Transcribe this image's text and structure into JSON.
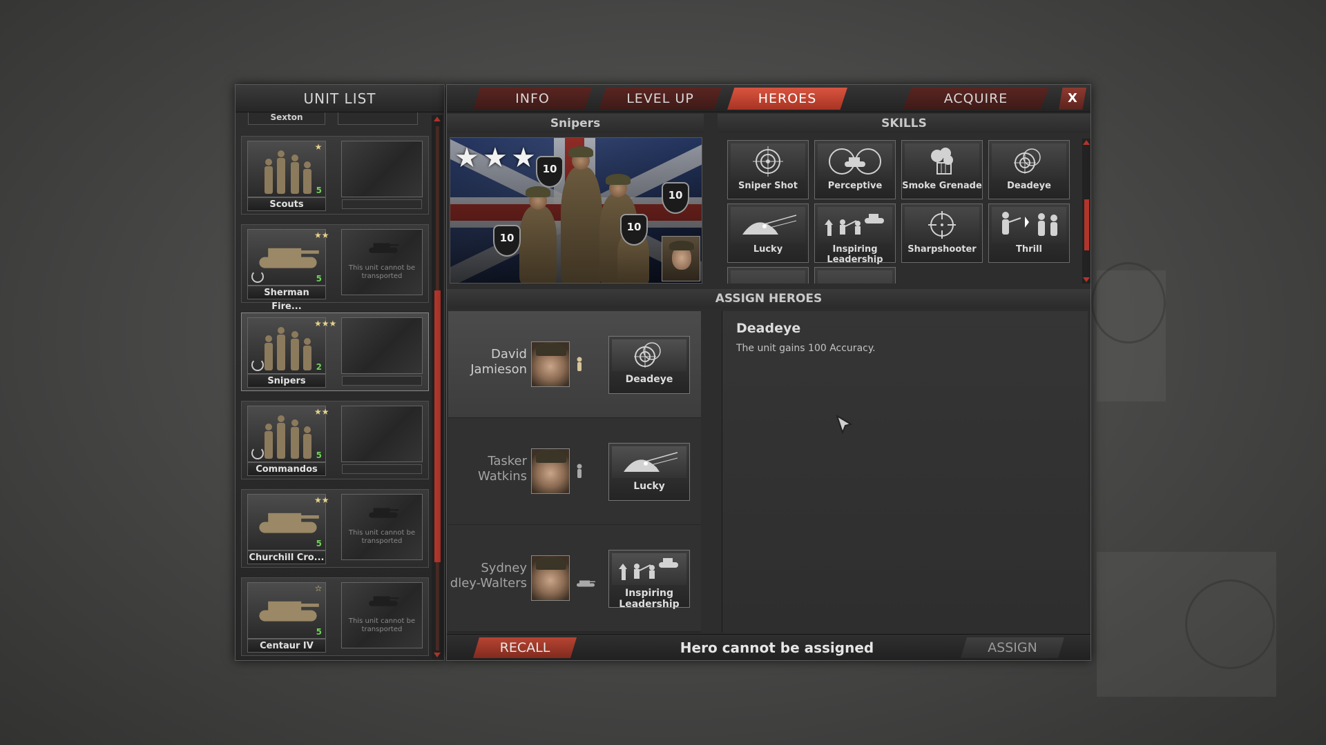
{
  "unit_list": {
    "title": "UNIT LIST",
    "partial_top_unit": "Sexton",
    "units": [
      {
        "name": "Scouts",
        "stars": "★",
        "count": "5",
        "veteran": false,
        "kind": "infantry",
        "transport": "empty"
      },
      {
        "name": "Sherman Fire...",
        "stars": "★★",
        "count": "5",
        "veteran": true,
        "kind": "tank",
        "transport": "none"
      },
      {
        "name": "Snipers",
        "stars": "★★★",
        "count": "2",
        "veteran": true,
        "kind": "infantry",
        "transport": "empty",
        "selected": true
      },
      {
        "name": "Commandos",
        "stars": "★★",
        "count": "5",
        "veteran": true,
        "kind": "infantry",
        "transport": "empty"
      },
      {
        "name": "Churchill Cro...",
        "stars": "★★",
        "count": "5",
        "veteran": false,
        "kind": "tank",
        "transport": "none"
      },
      {
        "name": "Centaur IV",
        "stars": "☆",
        "count": "5",
        "veteran": false,
        "kind": "tank",
        "transport": "none"
      }
    ],
    "no_transport_text": "This unit cannot be transported"
  },
  "tabs": {
    "info": "INFO",
    "level_up": "LEVEL UP",
    "heroes": "HEROES",
    "acquire": "ACQUIRE",
    "close": "X"
  },
  "unit_panel": {
    "title": "Snipers",
    "stars": "★★★",
    "ranks": [
      "10",
      "10",
      "10",
      "10"
    ]
  },
  "skills": {
    "title": "SKILLS",
    "items": [
      {
        "label": "Sniper Shot",
        "icon": "crosshair-icon"
      },
      {
        "label": "Perceptive",
        "icon": "tank-scope-icon"
      },
      {
        "label": "Smoke Grenade",
        "icon": "smoke-icon"
      },
      {
        "label": "Deadeye",
        "icon": "target-rings-icon"
      },
      {
        "label": "Lucky",
        "icon": "helmet-icon"
      },
      {
        "label": "Inspiring Leadership",
        "icon": "charge-icon"
      },
      {
        "label": "Sharpshooter",
        "icon": "reticle-icon"
      },
      {
        "label": "Thrill",
        "icon": "soldiers-icon"
      }
    ]
  },
  "assign": {
    "title": "ASSIGN HEROES",
    "heroes": [
      {
        "name_line1": "David",
        "name_line2": "Jamieson",
        "type": "infantry",
        "skill": "Deadeye",
        "selected": true
      },
      {
        "name_line1": "Tasker",
        "name_line2": "Watkins",
        "type": "infantry",
        "skill": "Lucky",
        "selected": false
      },
      {
        "name_line1": "Sydney",
        "name_line2": "dley-Walters",
        "type": "tank",
        "skill": "Inspiring Leadership",
        "selected": false
      }
    ]
  },
  "detail": {
    "title": "Deadeye",
    "description": "The unit gains 100 Accuracy."
  },
  "footer": {
    "recall": "RECALL",
    "status": "Hero cannot be assigned",
    "assign": "ASSIGN"
  }
}
